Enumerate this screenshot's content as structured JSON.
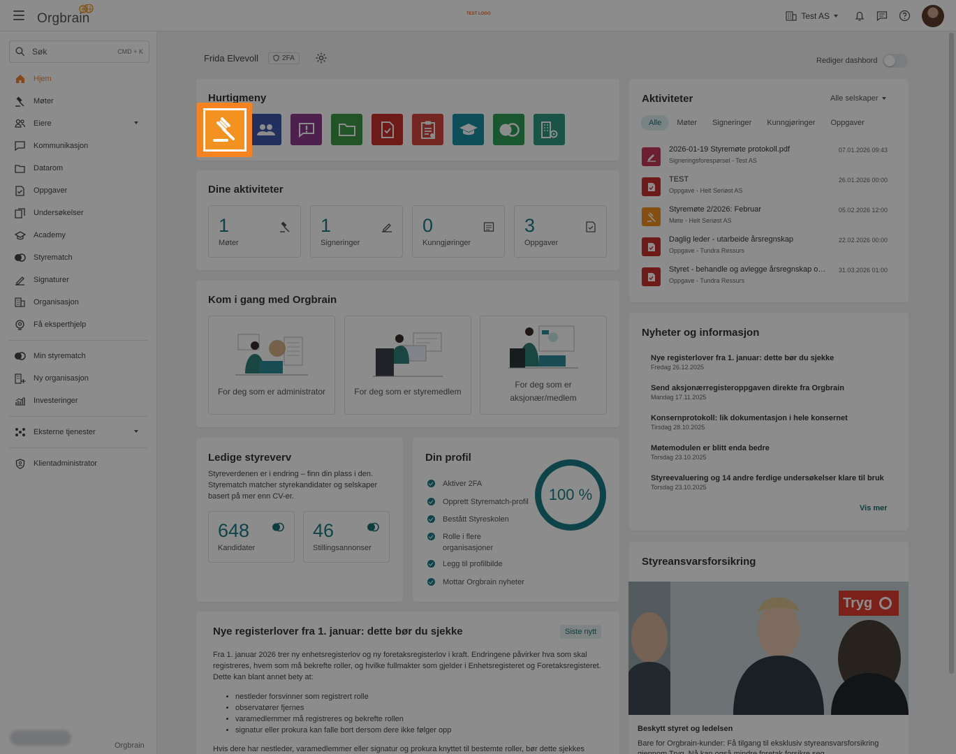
{
  "topbar": {
    "logo": "Orgbrain",
    "test_logo": "TEST LOGO",
    "company": "Test AS"
  },
  "search": {
    "label": "Søk",
    "shortcut": "CMD + K"
  },
  "sidebar": {
    "items": [
      {
        "label": "Hjem",
        "icon": "home-icon"
      },
      {
        "label": "Møter",
        "icon": "gavel-icon"
      },
      {
        "label": "Eiere",
        "icon": "owners-icon"
      },
      {
        "label": "Kommunikasjon",
        "icon": "chat-icon"
      },
      {
        "label": "Datarom",
        "icon": "folder-icon"
      },
      {
        "label": "Oppgaver",
        "icon": "task-icon"
      },
      {
        "label": "Undersøkelser",
        "icon": "survey-icon"
      },
      {
        "label": "Academy",
        "icon": "academy-icon"
      },
      {
        "label": "Styrematch",
        "icon": "match-icon"
      },
      {
        "label": "Signaturer",
        "icon": "pen-icon"
      },
      {
        "label": "Organisasjon",
        "icon": "building-icon"
      },
      {
        "label": "Få eksperthjelp",
        "icon": "expert-icon"
      }
    ],
    "items2": [
      {
        "label": "Min styrematch",
        "icon": "match-icon"
      },
      {
        "label": "Ny organisasjon",
        "icon": "new-org-icon"
      },
      {
        "label": "Investeringer",
        "icon": "chart-icon"
      }
    ],
    "external": "Eksterne tjenester",
    "client_admin": "Klientadministrator",
    "footer_logo": "Orgbrain"
  },
  "header": {
    "user": "Frida Elvevoll",
    "badge": "2FA",
    "edit_dashboard": "Rediger dashbord"
  },
  "quickmenu": {
    "title": "Hurtigmeny",
    "colors": [
      "#f39121",
      "#3d58a8",
      "#8d3a8a",
      "#3f9a47",
      "#c9302c",
      "#d4473f",
      "#1b8fa1",
      "#2e9e5a",
      "#2f9a82"
    ]
  },
  "activities_summary": {
    "title": "Dine aktiviteter",
    "stats": [
      {
        "num": "1",
        "label": "Møter"
      },
      {
        "num": "1",
        "label": "Signeringer"
      },
      {
        "num": "0",
        "label": "Kunngjøringer"
      },
      {
        "num": "3",
        "label": "Oppgaver"
      }
    ]
  },
  "getting_started": {
    "title": "Kom i gang med Orgbrain",
    "cards": [
      {
        "label": "For deg som er administrator"
      },
      {
        "label": "For deg som er styremedlem"
      },
      {
        "label": "For deg som er aksjonær/medlem"
      }
    ]
  },
  "vacancies": {
    "title": "Ledige styreverv",
    "desc": "Styreverdenen er i endring – finn din plass i den. Styrematch matcher styrekandidater og selskaper basert på mer enn CV-er.",
    "stats": [
      {
        "num": "648",
        "label": "Kandidater"
      },
      {
        "num": "46",
        "label": "Stillingsannonser"
      }
    ]
  },
  "profile": {
    "title": "Din profil",
    "percent": "100 %",
    "checks": [
      "Aktiver 2FA",
      "Opprett Styrematch-profil",
      "Bestått Styreskolen",
      "Rolle i flere organisasjoner",
      "Legg til profilbilde",
      "Mottar Orgbrain nyheter"
    ]
  },
  "article": {
    "title": "Nye registerlover fra 1. januar: dette bør du sjekke",
    "pill": "Siste nytt",
    "p1": "Fra 1. januar 2026 trer ny enhetsregisterlov og ny foretaksregisterlov i kraft. Endringene påvirker hva som skal registreres, hvem som må bekrefte roller, og hvilke fullmakter som gjelder i Enhetsregisteret og Foretaksregisteret. Dette kan blant annet bety at:",
    "bullets": [
      "nestleder forsvinner som registrert rolle",
      "observatører fjernes",
      "varamedlemmer må registreres og bekrefte rollen",
      "signatur eller prokura kan falle bort dersom dere ikke følger opp"
    ],
    "p2": "Hvis dere har nestleder, varamedlemmer eller signatur og prokura knyttet til bestemte roller, bør dette sjekkes"
  },
  "activities": {
    "title": "Aktiviteter",
    "filter": "Alle selskaper",
    "tabs": [
      "Alle",
      "Møter",
      "Signeringer",
      "Kunngjøringer",
      "Oppgaver"
    ],
    "items": [
      {
        "title": "2026-01-19 Styremøte protokoll.pdf",
        "sub": "Signeringsforespørsel - Test AS",
        "date": "07.01.2026 09:43",
        "color": "#c73a5a",
        "icon": "pen-icon"
      },
      {
        "title": "TEST",
        "sub": "Oppgave - Helt Seriøst AS",
        "date": "26.01.2026 00:00",
        "color": "#c9302c",
        "icon": "task-icon"
      },
      {
        "title": "Styremøte 2/2026: Februar",
        "sub": "Møte - Helt Seriøst AS",
        "date": "05.02.2026 12:00",
        "color": "#f39121",
        "icon": "gavel-icon"
      },
      {
        "title": "Daglig leder - utarbeide årsregnskap",
        "sub": "Oppgave - Tundra Ressurs",
        "date": "22.02.2026 00:00",
        "color": "#c9302c",
        "icon": "task-icon"
      },
      {
        "title": "Styret - behandle og avlegge årsregnskap og årsberetning",
        "sub": "Oppgave - Tundra Ressurs",
        "date": "31.03.2026 01:00",
        "color": "#c9302c",
        "icon": "task-icon"
      }
    ]
  },
  "news": {
    "title": "Nyheter og informasjon",
    "more": "Vis mer",
    "items": [
      {
        "title": "Nye registerlover fra 1. januar: dette bør du sjekke",
        "date": "Fredag 26.12.2025"
      },
      {
        "title": "Send aksjonærregisteroppgaven direkte fra Orgbrain",
        "date": "Mandag 17.11.2025"
      },
      {
        "title": "Konsernprotokoll: lik dokumentasjon i hele konsernet",
        "date": "Tirsdag 28.10.2025"
      },
      {
        "title": "Møtemodulen er blitt enda bedre",
        "date": "Torsdag 23.10.2025"
      },
      {
        "title": "Styreevaluering og 14 andre ferdige undersøkelser klare til bruk",
        "date": "Torsdag 23.10.2025"
      }
    ]
  },
  "insurance": {
    "title": "Styreansvarsforsikring",
    "brand": "Tryg",
    "subtitle": "Beskytt styret og ledelsen",
    "body": "Bare for Orgbrain-kunder: Få tilgang til eksklusiv styreansvarsforsikring gjennom Tryg. Nå kan også mindre foretak forsikre seg."
  }
}
